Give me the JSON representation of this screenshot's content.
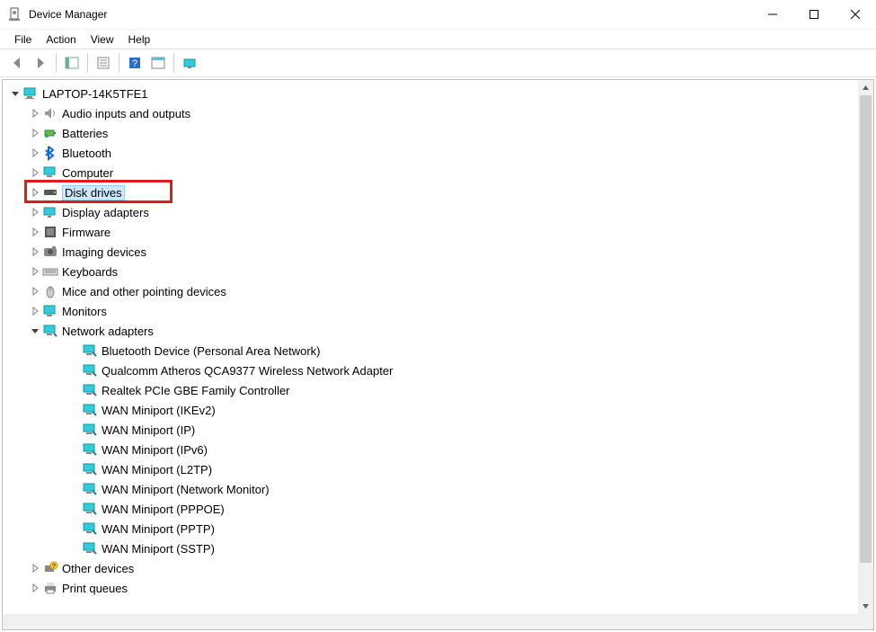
{
  "window": {
    "title": "Device Manager"
  },
  "menu": {
    "file": "File",
    "action": "Action",
    "view": "View",
    "help": "Help"
  },
  "tree": {
    "root": {
      "label": "LAPTOP-14K5TFE1",
      "expanded": true
    },
    "categories": [
      {
        "label": "Audio inputs and outputs",
        "icon": "audio",
        "expanded": false
      },
      {
        "label": "Batteries",
        "icon": "battery",
        "expanded": false
      },
      {
        "label": "Bluetooth",
        "icon": "bluetooth",
        "expanded": false
      },
      {
        "label": "Computer",
        "icon": "computer",
        "expanded": false
      },
      {
        "label": "Disk drives",
        "icon": "disk",
        "expanded": false,
        "selected": true,
        "highlighted": true
      },
      {
        "label": "Display adapters",
        "icon": "display",
        "expanded": false
      },
      {
        "label": "Firmware",
        "icon": "firmware",
        "expanded": false
      },
      {
        "label": "Imaging devices",
        "icon": "imaging",
        "expanded": false
      },
      {
        "label": "Keyboards",
        "icon": "keyboard",
        "expanded": false
      },
      {
        "label": "Mice and other pointing devices",
        "icon": "mouse",
        "expanded": false
      },
      {
        "label": "Monitors",
        "icon": "monitor",
        "expanded": false
      },
      {
        "label": "Network adapters",
        "icon": "network",
        "expanded": true,
        "children": [
          {
            "label": "Bluetooth Device (Personal Area Network)"
          },
          {
            "label": "Qualcomm Atheros QCA9377 Wireless Network Adapter"
          },
          {
            "label": "Realtek PCIe GBE Family Controller"
          },
          {
            "label": "WAN Miniport (IKEv2)"
          },
          {
            "label": "WAN Miniport (IP)"
          },
          {
            "label": "WAN Miniport (IPv6)"
          },
          {
            "label": "WAN Miniport (L2TP)"
          },
          {
            "label": "WAN Miniport (Network Monitor)"
          },
          {
            "label": "WAN Miniport (PPPOE)"
          },
          {
            "label": "WAN Miniport (PPTP)"
          },
          {
            "label": "WAN Miniport (SSTP)"
          }
        ]
      },
      {
        "label": "Other devices",
        "icon": "other",
        "expanded": false
      },
      {
        "label": "Print queues",
        "icon": "printer",
        "expanded": false
      }
    ]
  }
}
